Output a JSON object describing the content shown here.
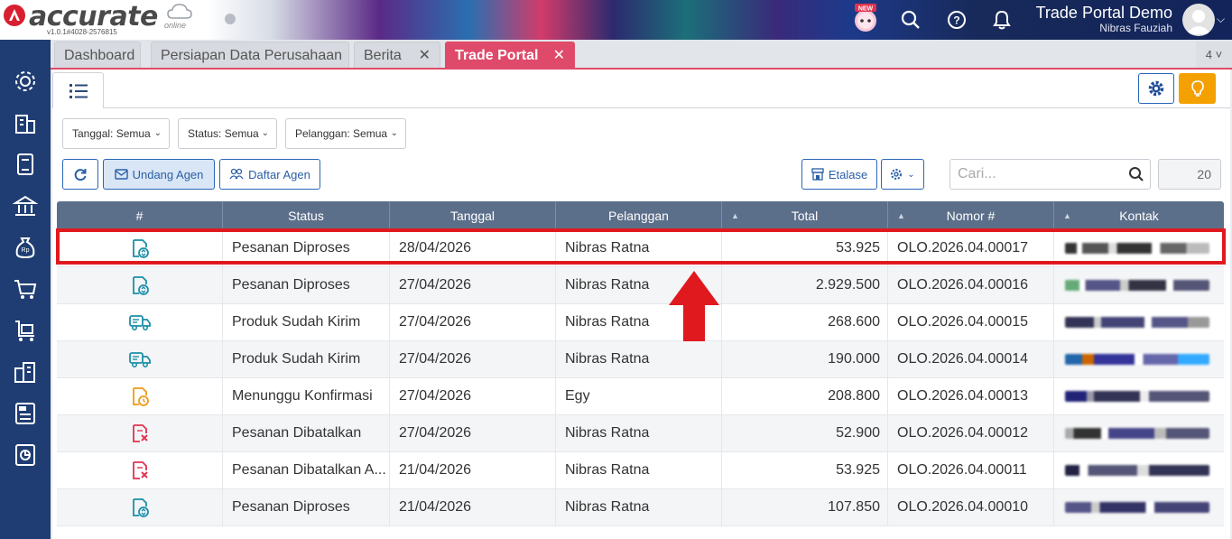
{
  "app": {
    "logo_text": "accurate",
    "logo_online": "online",
    "version": "v1.0.1#4028-2576815",
    "new_badge": "NEW",
    "company": "Trade Portal Demo",
    "user": "Nibras Fauziah"
  },
  "tabs": [
    {
      "label": "Dashboard",
      "closable": false,
      "active": false
    },
    {
      "label": "Persiapan Data Perusahaan",
      "closable": false,
      "active": false
    },
    {
      "label": "Berita",
      "closable": true,
      "active": false
    },
    {
      "label": "Trade Portal",
      "closable": true,
      "active": true
    }
  ],
  "tab_count": "4",
  "filters": {
    "date": "Tanggal: Semua",
    "status": "Status: Semua",
    "customer": "Pelanggan: Semua"
  },
  "toolbar": {
    "invite_agent": "Undang Agen",
    "agent_list": "Daftar Agen",
    "etalase": "Etalase",
    "search_placeholder": "Cari...",
    "page_size": "20"
  },
  "table": {
    "columns": [
      "#",
      "Status",
      "Tanggal",
      "Pelanggan",
      "Total",
      "Nomor #",
      "Kontak"
    ],
    "rows": [
      {
        "icon": "order-processing-icon",
        "icon_color": "#1b8fa8",
        "status": "Pesanan Diproses",
        "date": "28/04/2026",
        "customer": "Nibras Ratna",
        "total": "53.925",
        "number": "OLO.2026.04.00017"
      },
      {
        "icon": "order-processing-icon",
        "icon_color": "#1b8fa8",
        "status": "Pesanan Diproses",
        "date": "27/04/2026",
        "customer": "Nibras Ratna",
        "total": "2.929.500",
        "number": "OLO.2026.04.00016"
      },
      {
        "icon": "truck-icon",
        "icon_color": "#1b8fa8",
        "status": "Produk Sudah Kirim",
        "date": "27/04/2026",
        "customer": "Nibras Ratna",
        "total": "268.600",
        "number": "OLO.2026.04.00015"
      },
      {
        "icon": "truck-icon",
        "icon_color": "#1b8fa8",
        "status": "Produk Sudah Kirim",
        "date": "27/04/2026",
        "customer": "Nibras Ratna",
        "total": "190.000",
        "number": "OLO.2026.04.00014"
      },
      {
        "icon": "pending-confirmation-icon",
        "icon_color": "#f09a15",
        "status": "Menunggu Konfirmasi",
        "date": "27/04/2026",
        "customer": "Egy",
        "total": "208.800",
        "number": "OLO.2026.04.00013"
      },
      {
        "icon": "order-cancelled-icon",
        "icon_color": "#e0334f",
        "status": "Pesanan Dibatalkan",
        "date": "27/04/2026",
        "customer": "Nibras Ratna",
        "total": "52.900",
        "number": "OLO.2026.04.00012"
      },
      {
        "icon": "order-cancelled-icon",
        "icon_color": "#e0334f",
        "status": "Pesanan Dibatalkan A...",
        "date": "21/04/2026",
        "customer": "Nibras Ratna",
        "total": "53.925",
        "number": "OLO.2026.04.00011"
      },
      {
        "icon": "order-processing-icon",
        "icon_color": "#1b8fa8",
        "status": "Pesanan Diproses",
        "date": "21/04/2026",
        "customer": "Nibras Ratna",
        "total": "107.850",
        "number": "OLO.2026.04.00010"
      }
    ]
  },
  "colors": {
    "accent": "#e04a6a",
    "primary": "#2a66b8",
    "sidebar": "#1f3d73",
    "header_row": "#5c6f8a",
    "highlight": "#e0191f"
  }
}
